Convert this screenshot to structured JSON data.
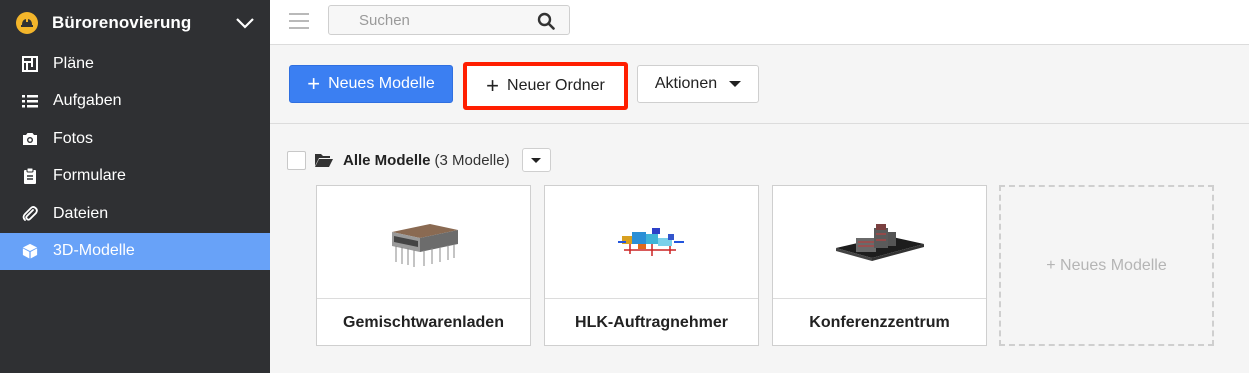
{
  "sidebar": {
    "project_name": "Bürorenovierung",
    "project_icon": "hardhat-icon",
    "items": [
      {
        "label": "Pläne",
        "icon": "plan-icon",
        "active": false
      },
      {
        "label": "Aufgaben",
        "icon": "list-icon",
        "active": false
      },
      {
        "label": "Fotos",
        "icon": "camera-icon",
        "active": false
      },
      {
        "label": "Formulare",
        "icon": "clipboard-icon",
        "active": false
      },
      {
        "label": "Dateien",
        "icon": "paperclip-icon",
        "active": false
      },
      {
        "label": "3D-Modelle",
        "icon": "cube-icon",
        "active": true
      }
    ]
  },
  "topbar": {
    "search_placeholder": "Suchen"
  },
  "toolbar": {
    "new_model": "Neues Modelle",
    "new_folder": "Neuer Ordner",
    "actions": "Aktionen"
  },
  "folder": {
    "title": "Alle Modelle",
    "count": "(3 Modelle)"
  },
  "models": [
    {
      "name": "Gemischtwarenladen"
    },
    {
      "name": "HLK-Auftragnehmer"
    },
    {
      "name": "Konferenzzentrum"
    }
  ],
  "new_model_card": "+ Neues Modelle",
  "colors": {
    "sidebar_bg": "#2f3033",
    "active_item": "#68a2f8",
    "primary_button": "#3b7ff2",
    "highlight_border": "#ff1e00",
    "logo": "#f3b52b"
  }
}
